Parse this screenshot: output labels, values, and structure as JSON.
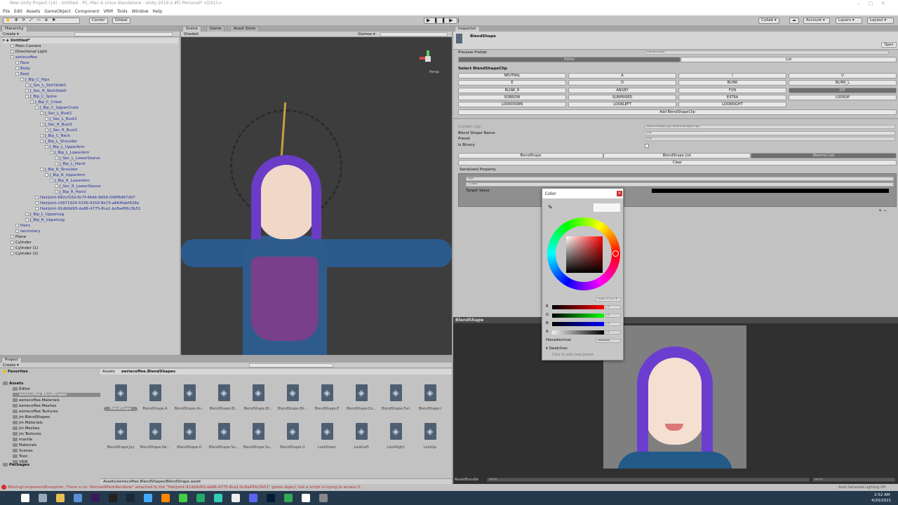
{
  "window": {
    "title": "New Unity Project (14) - Untitled - PC, Mac & Linux Standalone - Unity 2019.2.4f1 Personal* <DX11>"
  },
  "menu": [
    "File",
    "Edit",
    "Assets",
    "GameObject",
    "Component",
    "VRM",
    "Tools",
    "Window",
    "Help"
  ],
  "toolbar": {
    "center": "Center",
    "global": "Global",
    "collab": "Collab ▾",
    "account": "Account ▾",
    "layers": "Layers ▾",
    "layout": "Layout ▾"
  },
  "hierarchy": {
    "tab": "Hierarchy",
    "create": "Create ▾",
    "scene": "Untitled*",
    "items": [
      {
        "label": "Main Camera",
        "depth": 1,
        "prefab": false
      },
      {
        "label": "Directional Light",
        "depth": 1,
        "prefab": false
      },
      {
        "label": "eeriecoffee",
        "depth": 1,
        "prefab": true
      },
      {
        "label": "Face",
        "depth": 2,
        "prefab": true
      },
      {
        "label": "Body",
        "depth": 2,
        "prefab": true
      },
      {
        "label": "Root",
        "depth": 2,
        "prefab": true
      },
      {
        "label": "J_Bip_C_Hips",
        "depth": 3,
        "prefab": true
      },
      {
        "label": "J_Sec_L_SkirtSide0",
        "depth": 4,
        "prefab": true
      },
      {
        "label": "J_Sec_R_SkirtSide0",
        "depth": 4,
        "prefab": true
      },
      {
        "label": "J_Bip_C_Spine",
        "depth": 4,
        "prefab": true
      },
      {
        "label": "J_Bip_C_Chest",
        "depth": 5,
        "prefab": true
      },
      {
        "label": "J_Bip_C_UpperChest",
        "depth": 6,
        "prefab": true
      },
      {
        "label": "J_Sec_L_Bust1",
        "depth": 7,
        "prefab": true
      },
      {
        "label": "J_Sec_L_Bust2",
        "depth": 8,
        "prefab": true
      },
      {
        "label": "J_Sec_R_Bust1",
        "depth": 7,
        "prefab": true
      },
      {
        "label": "J_Sec_R_Bust2",
        "depth": 8,
        "prefab": true
      },
      {
        "label": "J_Bip_C_Neck",
        "depth": 7,
        "prefab": true
      },
      {
        "label": "J_Bip_L_Shoulder",
        "depth": 7,
        "prefab": true
      },
      {
        "label": "J_Bip_L_UpperArm",
        "depth": 8,
        "prefab": true
      },
      {
        "label": "J_Bip_L_LowerArm",
        "depth": 9,
        "prefab": true
      },
      {
        "label": "J_Sec_L_LowerSleeve",
        "depth": 10,
        "prefab": true
      },
      {
        "label": "J_Bip_L_Hand",
        "depth": 10,
        "prefab": true
      },
      {
        "label": "J_Bip_R_Shoulder",
        "depth": 7,
        "prefab": true
      },
      {
        "label": "J_Bip_R_UpperArm",
        "depth": 8,
        "prefab": true
      },
      {
        "label": "J_Bip_R_LowerArm",
        "depth": 9,
        "prefab": true
      },
      {
        "label": "J_Sec_R_LowerSleeve",
        "depth": 10,
        "prefab": true
      },
      {
        "label": "J_Bip_R_Hand",
        "depth": 10,
        "prefab": true
      },
      {
        "label": "HairJoint-692cf16d-6c7f-44db-9b58-048f8d67d07",
        "depth": 6,
        "prefab": true
      },
      {
        "label": "HairJoint-c0971924-5336-4159-8e73-a664fabf426e",
        "depth": 6,
        "prefab": true
      },
      {
        "label": "HairJoint-91db9d93-da86-4775-8ca1-bc8a456c3b51",
        "depth": 6,
        "prefab": true
      },
      {
        "label": "J_Bip_L_UpperLeg",
        "depth": 4,
        "prefab": true
      },
      {
        "label": "J_Bip_R_UpperLeg",
        "depth": 4,
        "prefab": true
      },
      {
        "label": "Hairs",
        "depth": 2,
        "prefab": true
      },
      {
        "label": "secondary",
        "depth": 2,
        "prefab": true
      },
      {
        "label": "Plane",
        "depth": 1,
        "prefab": false
      },
      {
        "label": "Cylinder",
        "depth": 1,
        "prefab": false
      },
      {
        "label": "Cylinder (1)",
        "depth": 1,
        "prefab": false
      },
      {
        "label": "Cylinder (2)",
        "depth": 1,
        "prefab": false
      }
    ]
  },
  "scene": {
    "tabs": [
      "Scene",
      "Game",
      "Asset Store"
    ],
    "shading": "Shaded",
    "gizmos": "Gizmos ▾",
    "persp": "Persp"
  },
  "inspector": {
    "tab": "Inspector",
    "object": "BlendShape",
    "open": "Open",
    "preview_prefab_label": "Preview Prefab",
    "preview_prefab_value": "eeriecoffee",
    "mode_tabs": [
      "Editor",
      "List"
    ],
    "select_heading": "Select BlendShapeClip",
    "clips": [
      "NEUTRAL",
      "A",
      "I",
      "U",
      "E",
      "O",
      "BLINK",
      "BLINK_L",
      "BLINK_R",
      "ANGRY",
      "FUN",
      "JOY",
      "SORROW",
      "SURPRISED",
      "EXTRA",
      "LOOKUP",
      "LOOKDOWN",
      "LOOKLEFT",
      "LOOKRIGHT"
    ],
    "selected_clip": "JOY",
    "add_clip": "Add BlendShapeClip",
    "current_clip_label": "Current clip",
    "current_clip_value": "BlendShape.Joy (BlendShapeClip)",
    "blend_shape_name_label": "Blend Shape Name",
    "blend_shape_name_value": "Joy",
    "preset_label": "Preset",
    "preset_value": "Joy",
    "is_binary_label": "Is Binary",
    "is_binary": false,
    "list_tabs": [
      "BlendShape",
      "BlendShape List",
      "Material List"
    ],
    "clear": "Clear",
    "serialized_property": "Serialized Property",
    "material_value": "eye",
    "property_value": "_Color",
    "target_value_label": "Target Value",
    "target_color": "#000000"
  },
  "color_picker": {
    "title": "Color",
    "mode": "RGB 0-255 ▾",
    "r_label": "R",
    "g_label": "G",
    "b_label": "B",
    "a_label": "A",
    "r": "0",
    "g": "0",
    "b": "0",
    "a": "0",
    "hex_label": "Hexadecimal",
    "hex": "000000",
    "swatches": "▾ Swatches",
    "add_preset": "Click to add new preset"
  },
  "preview": {
    "title": "BlendShape",
    "assetbundle_label": "AssetBundle",
    "assetbundle_value": "None",
    "variant_value": "None"
  },
  "project": {
    "tab": "Project",
    "create": "Create ▾",
    "breadcrumb_root": "Assets",
    "breadcrumb_current": "eeriecoffee.BlendShapes",
    "tree": [
      {
        "label": "Favorites",
        "depth": 0,
        "bold": true
      },
      {
        "label": "Assets",
        "depth": 0,
        "bold": true
      },
      {
        "label": "Editor",
        "depth": 1
      },
      {
        "label": "eeriecoffee.BlendShapes",
        "depth": 1,
        "selected": true
      },
      {
        "label": "eeriecoffee.Materials",
        "depth": 1
      },
      {
        "label": "eeriecoffee.Meshes",
        "depth": 1
      },
      {
        "label": "eeriecoffee.Textures",
        "depth": 1
      },
      {
        "label": "jm.BlendShapes",
        "depth": 1
      },
      {
        "label": "jm.Materials",
        "depth": 1
      },
      {
        "label": "jm.Meshes",
        "depth": 1
      },
      {
        "label": "jm.Textures",
        "depth": 1
      },
      {
        "label": "mantle",
        "depth": 1
      },
      {
        "label": "Materials",
        "depth": 1
      },
      {
        "label": "Scenes",
        "depth": 1
      },
      {
        "label": "Toon",
        "depth": 1
      },
      {
        "label": "VRM",
        "depth": 1
      },
      {
        "label": "Packages",
        "depth": 0,
        "bold": true
      }
    ],
    "assets": [
      "BlendShape",
      "BlendShape.A",
      "BlendShape.An...",
      "BlendShape.Bl...",
      "BlendShape.Bl...",
      "BlendShape.Bli...",
      "BlendShape.E",
      "BlendShape.Ex...",
      "BlendShape.Fun",
      "BlendShape.I",
      "BlendShape.Joy",
      "BlendShape.Ne...",
      "BlendShape.O",
      "BlendShape.So...",
      "BlendShape.Su...",
      "BlendShape.U",
      "LookDown",
      "LookLeft",
      "LookRight",
      "LookUp"
    ],
    "path": "Assets/eeriecoffee.BlendShapes/BlendShape.asset"
  },
  "status": {
    "error": "MissingComponentException: There is no 'SkinnedMeshRenderer' attached to the \"HairJoint-91db9d93-da86-4775-8ca1-bc8a456c3b51\" game object, but a script is trying to access it.",
    "lighting": "Auto Generate Lighting Off"
  },
  "taskbar": {
    "time": "2:52 AM",
    "date": "4/20/2021",
    "apps": [
      "windows-start",
      "task-view",
      "file-explorer",
      "paint",
      "premiere",
      "obs",
      "steam",
      "affinity",
      "vpn",
      "chrome",
      "terminal",
      "clip-studio",
      "discord",
      "photoshop",
      "lp",
      "unity-hub",
      "vroid",
      "unity"
    ]
  },
  "colors": {
    "prefab_text": "#1f2f9a",
    "selected": "#6e6e6e",
    "error": "#d32f2f",
    "taskbar": "#253a4c"
  }
}
